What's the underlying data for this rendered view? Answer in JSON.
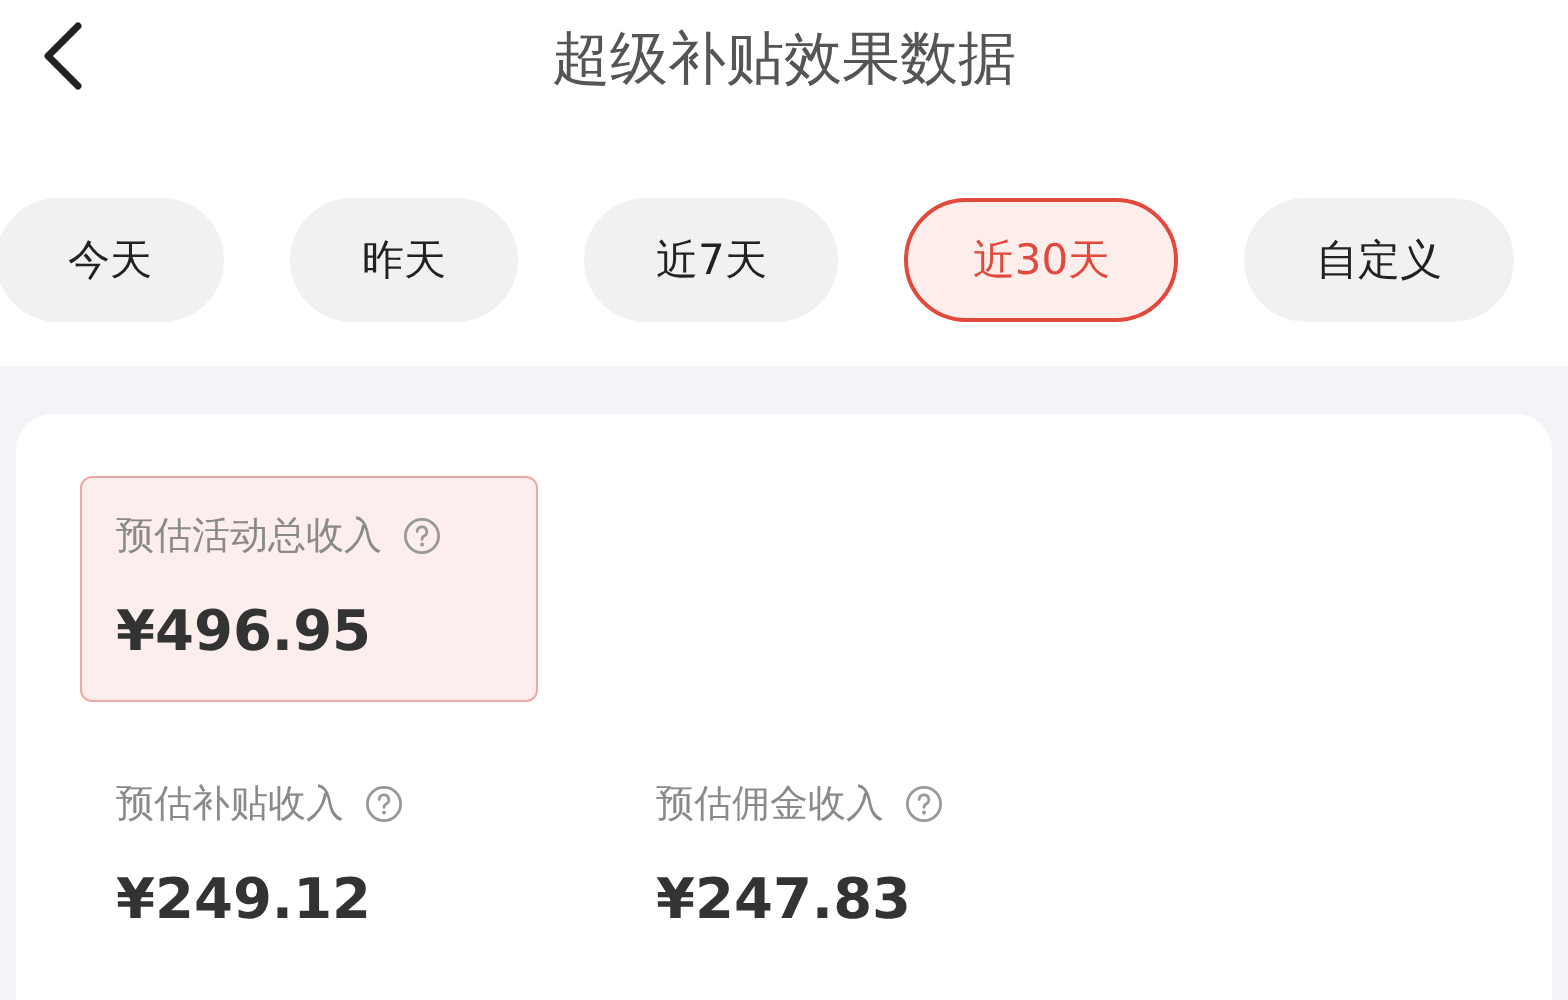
{
  "header": {
    "title": "超级补贴效果数据"
  },
  "tabs": [
    {
      "label": "今天",
      "selected": false
    },
    {
      "label": "昨天",
      "selected": false
    },
    {
      "label": "近7天",
      "selected": false
    },
    {
      "label": "近30天",
      "selected": true
    },
    {
      "label": "自定义",
      "selected": false
    }
  ],
  "total": {
    "label": "预估活动总收入",
    "value": "¥496.95"
  },
  "metrics": [
    {
      "label": "预估补贴收入",
      "value": "¥249.12"
    },
    {
      "label": "预估佣金收入",
      "value": "¥247.83"
    }
  ]
}
